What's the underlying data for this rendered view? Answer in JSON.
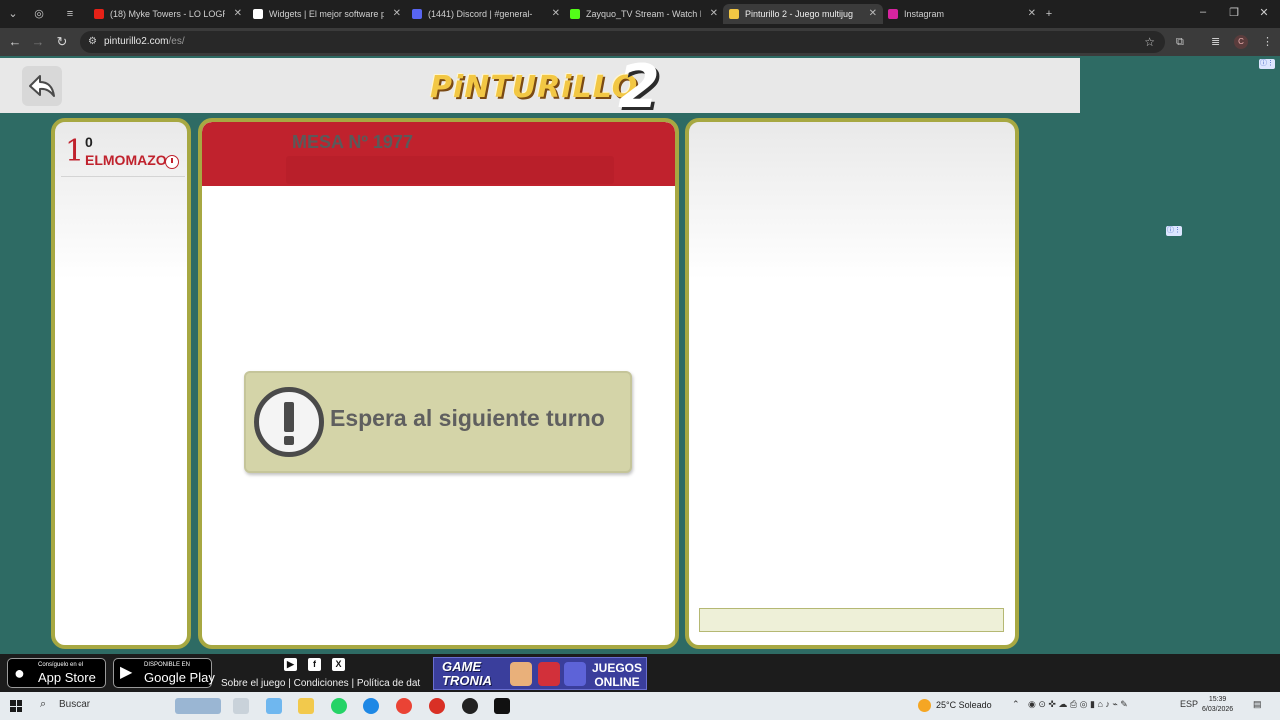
{
  "browser": {
    "tabs": [
      {
        "title": "(18) Myke Towers - LO LOGRÉ (",
        "color": "#e62117"
      },
      {
        "title": "Widgets | El mejor software pa",
        "color": "#ffffff"
      },
      {
        "title": "(1441) Discord | #general-",
        "color": "#5865f2"
      },
      {
        "title": "Zayquo_TV Stream - Watch Liv",
        "color": "#53fc18"
      },
      {
        "title": "Pinturillo 2 - Juego multijug",
        "color": "#f2c744"
      },
      {
        "title": "Instagram",
        "color": "#d6249f"
      }
    ],
    "active_tab_index": 4,
    "new_tab": "+",
    "url_host": "pinturillo2.com",
    "url_path": "/es/",
    "profile_initial": "C"
  },
  "game": {
    "logo_word": "PiNTURiLLO",
    "logo_number": "2",
    "back_icon": "back-arrow-icon",
    "players": [
      {
        "rank": "1",
        "score": "0",
        "name": "ELMOMAZO"
      }
    ],
    "table_title": "MESA Nº 1977",
    "wait_message": "Espera al siguiente turno",
    "colors": {
      "accent_red": "#c0222d",
      "panel_border": "#a7a842",
      "background": "#2e6b64"
    }
  },
  "footer": {
    "app_store_small": "Consíguelo en el",
    "app_store_big": "App Store",
    "google_play_small": "DISPONIBLE EN",
    "google_play_big": "Google Play",
    "social": [
      "youtube-icon",
      "facebook-icon",
      "x-icon"
    ],
    "links": "Sobre el juego | Condiciones | Política de dat",
    "banner_word1": "GAME",
    "banner_word2": "TRONIA",
    "banner_right1": "JUEGOS",
    "banner_right2": "ONLINE"
  },
  "taskbar": {
    "search": "Buscar",
    "weather": "25°C  Soleado",
    "lang": "ESP",
    "time": "15:39",
    "date": "6/03/2026"
  }
}
